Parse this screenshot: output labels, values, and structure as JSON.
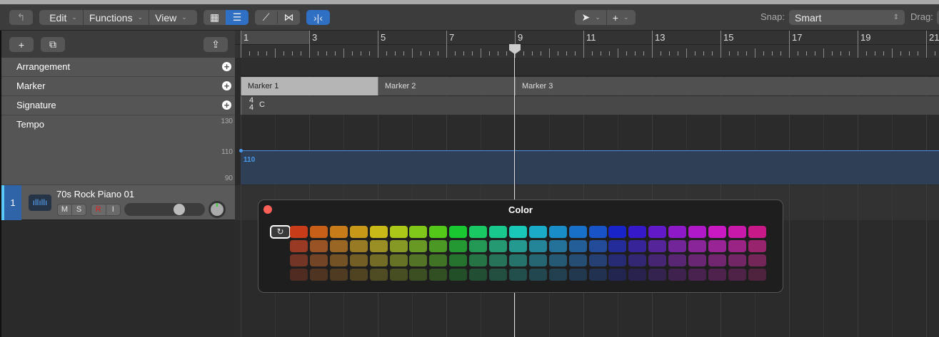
{
  "toolbar": {
    "back_icon": "back-arrow-icon",
    "edit": "Edit",
    "functions": "Functions",
    "view": "View",
    "snap_label": "Snap:",
    "snap_value": "Smart",
    "drag_label": "Drag:"
  },
  "ruler": {
    "bars": [
      "1",
      "3",
      "5",
      "7",
      "9",
      "11",
      "13",
      "15",
      "17",
      "19",
      "21"
    ],
    "playhead_bar": 9
  },
  "global_tracks": [
    {
      "label": "Arrangement"
    },
    {
      "label": "Marker"
    },
    {
      "label": "Signature"
    },
    {
      "label": "Tempo"
    }
  ],
  "markers": [
    {
      "label": "Marker 1",
      "bar": 1,
      "selected": true
    },
    {
      "label": "Marker 2",
      "bar": 5
    },
    {
      "label": "Marker 3",
      "bar": 9
    }
  ],
  "signature": {
    "numerator": "4",
    "denominator": "4",
    "key": "C"
  },
  "tempo": {
    "scale": [
      "130",
      "110",
      "90"
    ],
    "value": "110"
  },
  "track": {
    "number": "1",
    "name": "70s Rock Piano 01",
    "mute": "M",
    "solo": "S",
    "record": "R",
    "input": "I",
    "volume": 0.75,
    "color": "#5ac8fa"
  },
  "color_panel": {
    "title": "Color",
    "hues": [
      12,
      24,
      34,
      44,
      55,
      70,
      85,
      100,
      128,
      145,
      160,
      175,
      190,
      200,
      210,
      220,
      236,
      250,
      265,
      280,
      292,
      302,
      310,
      322
    ]
  }
}
